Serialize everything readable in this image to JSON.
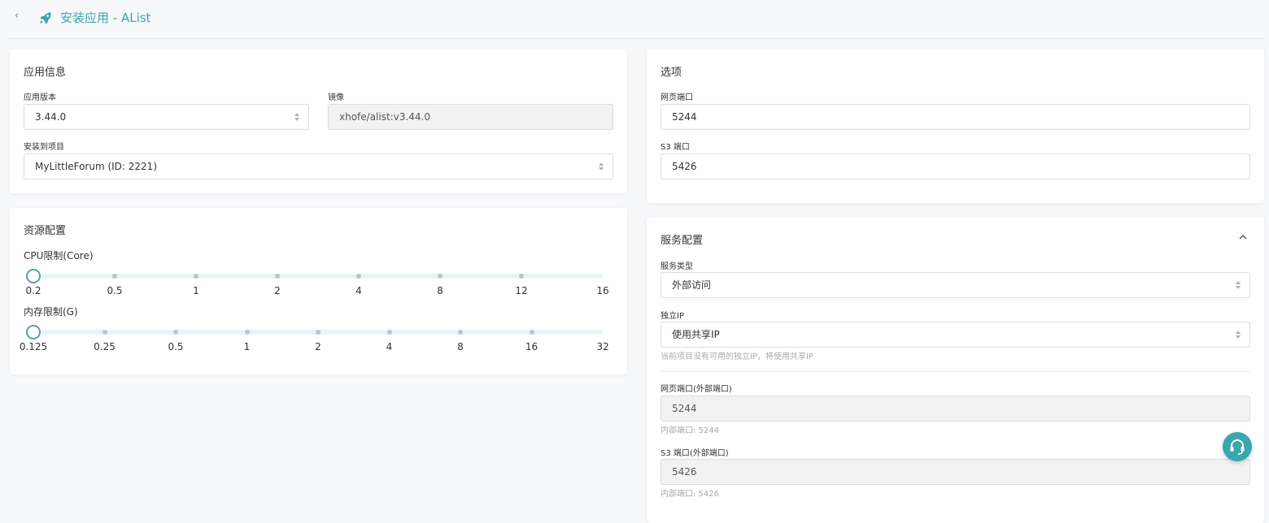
{
  "header": {
    "back_icon": "chevron-left-icon",
    "rocket_icon": "rocket-icon",
    "title": "安装应用 - AList"
  },
  "app_info": {
    "title": "应用信息",
    "version_label": "应用版本",
    "version_value": "3.44.0",
    "image_label": "镜像",
    "image_value": "xhofe/alist:v3.44.0",
    "project_label": "安装到项目",
    "project_value": "MyLittleForum (ID: 2221)"
  },
  "resources": {
    "title": "资源配置",
    "cpu_label": "CPU限制(Core)",
    "cpu_ticks": [
      "0.2",
      "0.5",
      "1",
      "2",
      "4",
      "8",
      "12",
      "16"
    ],
    "cpu_value": "0.2",
    "mem_label": "内存限制(G)",
    "mem_ticks": [
      "0.125",
      "0.25",
      "0.5",
      "1",
      "2",
      "4",
      "8",
      "16",
      "32"
    ],
    "mem_value": "0.125"
  },
  "options": {
    "title": "选项",
    "web_port_label": "网页端口",
    "web_port_value": "5244",
    "s3_port_label": "S3 端口",
    "s3_port_value": "5426"
  },
  "service": {
    "title": "服务配置",
    "collapse_icon": "chevron-up-icon",
    "type_label": "服务类型",
    "type_value": "外部访问",
    "ip_label": "独立IP",
    "ip_value": "使用共享IP",
    "ip_hint": "当前项目没有可用的独立IP，将使用共享IP",
    "web_ext_label": "网页端口(外部端口)",
    "web_ext_value": "5244",
    "web_int_hint": "内部端口: 5244",
    "s3_ext_label": "S3 端口(外部端口)",
    "s3_ext_value": "5426",
    "s3_int_hint": "内部端口: 5426"
  },
  "support_icon": "headset-icon",
  "colors": {
    "accent": "#3aa6b0"
  }
}
